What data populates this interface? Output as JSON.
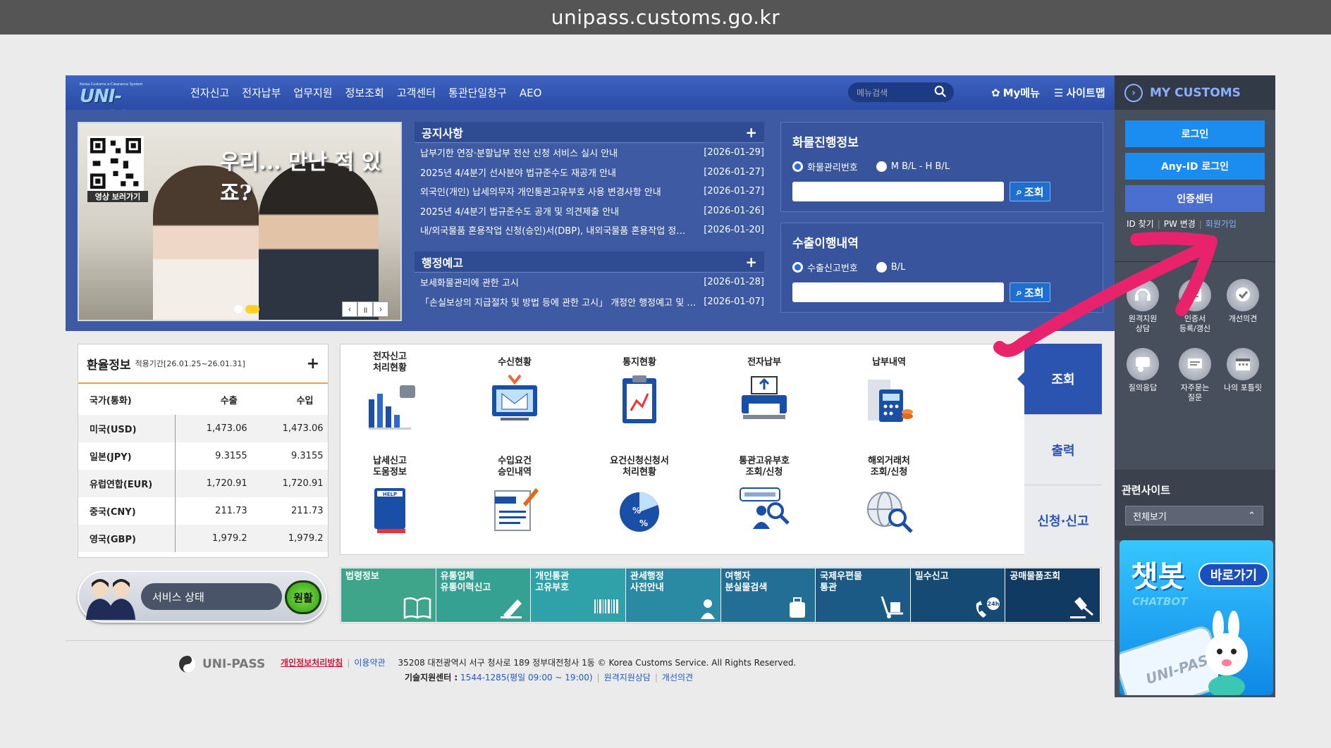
{
  "browser": {
    "url": "unipass.customs.go.kr"
  },
  "logo": {
    "small": "Korea Customs e-Clearance System",
    "big": "UNI-PASS"
  },
  "topnav": {
    "items": [
      "전자신고",
      "전자납부",
      "업무지원",
      "정보조회",
      "고객센터",
      "통관단일창구",
      "AEO"
    ],
    "search_placeholder": "메뉴검색",
    "mymenu": "My메뉴",
    "sitemap": "사이트맵"
  },
  "banner": {
    "slogan": "우리... 만난 적 있죠?",
    "qr_label": "영상 보러가기"
  },
  "notice": {
    "title": "공지사항",
    "items": [
      {
        "text": "납부기한 연장·분할납부 전산 신청 서비스 실시 안내",
        "date": "[2026-01-29]"
      },
      {
        "text": "2025년 4/4분기 선사분야 법규준수도 재공개 안내",
        "date": "[2026-01-27]"
      },
      {
        "text": "외국인(개인) 납세의무자 개인통관고유부호 사용 변경사항 안내",
        "date": "[2026-01-27]"
      },
      {
        "text": "2025년 4/4분기 법규준수도 공개 및 의견제출 안내",
        "date": "[2026-01-26]"
      },
      {
        "text": "내/외국물품 혼용작업 신청(승인)서(DBP), 내외국물품 혼용작업 정…",
        "date": "[2026-01-20]"
      }
    ]
  },
  "admin": {
    "title": "행정예고",
    "items": [
      {
        "text": "보세화물관리에 관한 고시",
        "date": "[2026-01-28]"
      },
      {
        "text": "「손실보상의 지급절차 및 방법 등에 관한 고시」 개정안 행정예고 및 …",
        "date": "[2026-01-07]"
      }
    ]
  },
  "cargo": {
    "title": "화물진행정보",
    "opt1": "화물관리번호",
    "opt2": "M B/L - H B/L",
    "btn": "조회"
  },
  "export": {
    "title": "수출이행내역",
    "opt1": "수출신고번호",
    "opt2": "B/L",
    "btn": "조회"
  },
  "exchange": {
    "title": "환율정보",
    "period": "적용기간[26.01.25~26.01.31]",
    "headers": [
      "국가(통화)",
      "수출",
      "수입"
    ],
    "rows": [
      [
        "미국(USD)",
        "1,473.06",
        "1,473.06"
      ],
      [
        "일본(JPY)",
        "9.3155",
        "9.3155"
      ],
      [
        "유럽연합(EUR)",
        "1,720.91",
        "1,720.91"
      ],
      [
        "중국(CNY)",
        "211.73",
        "211.73"
      ],
      [
        "영국(GBP)",
        "1,979.2",
        "1,979.2"
      ]
    ]
  },
  "service": {
    "label": "서비스 상태",
    "status": "원활"
  },
  "grid": {
    "row1": [
      "전자신고\n처리현황",
      "수신현황",
      "통지현황",
      "전자납부",
      "납부내역"
    ],
    "row2": [
      "납세신고\n도움정보",
      "수입요건\n승인내역",
      "요건신청신청서\n처리현황",
      "통관고유부호\n조회/신청",
      "해외거래처\n조회/신청"
    ]
  },
  "tabs": [
    "조회",
    "출력",
    "신청·신고"
  ],
  "quick": [
    {
      "label": "법령정보",
      "color": "#3fa58a"
    },
    {
      "label": "유통업체\n유통이력신고",
      "color": "#35a192"
    },
    {
      "label": "개인통관\n고유부호",
      "color": "#2fa1a8"
    },
    {
      "label": "관세행정\n사전안내",
      "color": "#2b8aa3"
    },
    {
      "label": "여행자\n분실물검색",
      "color": "#226e94"
    },
    {
      "label": "국제우편물\n통관",
      "color": "#1b5a85"
    },
    {
      "label": "밀수신고",
      "color": "#154a75"
    },
    {
      "label": "공매물품조회",
      "color": "#113a63"
    }
  ],
  "footer": {
    "logo": "UNI-PASS",
    "privacy": "개인정보처리방침",
    "terms": "이용약관",
    "address": "35208 대전광역시 서구 청사로 189 정부대전청사 1동 © Korea Customs Service. All Rights Reserved.",
    "support_label": "기술지원센터 :",
    "support_phone": "1544-1285(평일 09:00 ~ 19:00)",
    "remote": "원격지원상담",
    "improve": "개선의견"
  },
  "mycustoms": {
    "title": "MY CUSTOMS",
    "login": "로그인",
    "anyid": "Any-ID 로그인",
    "cert": "인증센터",
    "find_id": "ID 찾기",
    "pw_change": "PW 변경",
    "join": "회원가입",
    "icons": [
      "원격지원\n상담",
      "인증서\n등록/갱신",
      "개선의견",
      "질의응답",
      "자주묻는\n질문",
      "나의 포틀릿"
    ]
  },
  "related": {
    "title": "관련사이트",
    "select": "전체보기"
  },
  "chatbot": {
    "title": "챗봇",
    "sub": "CHATBOT",
    "go": "바로가기",
    "brand": "UNI-PASS"
  },
  "colors": {
    "nav": "#2f50ad",
    "hero": "#3d5aa2",
    "accent_arrow": "#e8236b",
    "side": "#474e5c"
  }
}
